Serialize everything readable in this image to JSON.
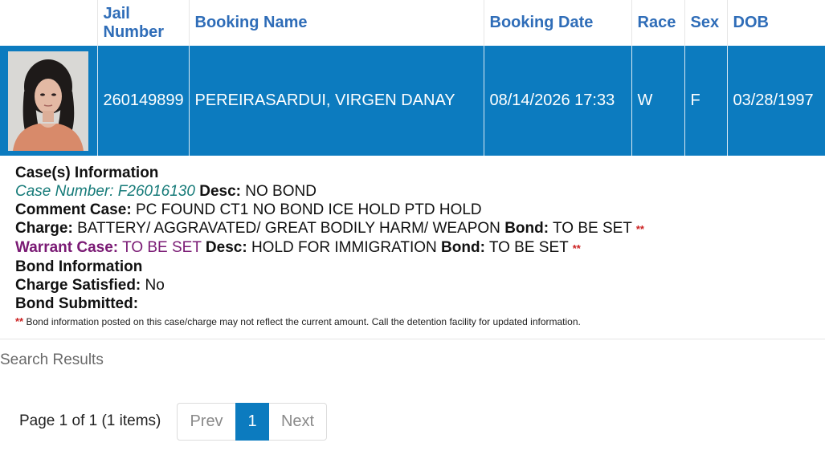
{
  "table": {
    "headers": {
      "photo": "",
      "jail_number": "Jail Number",
      "booking_name": "Booking Name",
      "booking_date": "Booking Date",
      "race": "Race",
      "sex": "Sex",
      "dob": "DOB"
    },
    "row": {
      "jail_number": "260149899",
      "booking_name": "PEREIRASARDUI, VIRGEN DANAY",
      "booking_date": "08/14/2026 17:33",
      "race": "W",
      "sex": "F",
      "dob": "03/28/1997"
    }
  },
  "case_info": {
    "title": "Case(s) Information",
    "case_number_label": "Case Number:",
    "case_number": "F26016130",
    "desc_label": "Desc:",
    "case_desc": "NO BOND",
    "comment_label": "Comment Case:",
    "comment": "PC FOUND CT1 NO BOND ICE HOLD PTD HOLD",
    "charge_label": "Charge:",
    "charge": "BATTERY/ AGGRAVATED/ GREAT BODILY HARM/ WEAPON",
    "bond_label": "Bond:",
    "charge_bond": "TO BE SET",
    "warrant_label": "Warrant Case:",
    "warrant_case": "TO BE SET",
    "warrant_desc_label": "Desc:",
    "warrant_desc": "HOLD FOR IMMIGRATION",
    "warrant_bond_label": "Bond:",
    "warrant_bond": "TO BE SET",
    "stars": "**",
    "bond_info_title": "Bond Information",
    "charge_satisfied_label": "Charge Satisfied:",
    "charge_satisfied": "No",
    "bond_submitted_label": "Bond Submitted:",
    "note": "Bond information posted on this case/charge may not reflect the current amount. Call the detention facility for updated information."
  },
  "search_results_label": "Search Results",
  "pagination": {
    "summary": "Page 1 of 1 (1 items)",
    "prev": "Prev",
    "current": "1",
    "next": "Next"
  },
  "colors": {
    "header_text": "#2f6db8",
    "selected_row": "#0c7bbf",
    "case_number": "#157a78",
    "warrant": "#7a1a74",
    "stars": "#cc2222"
  }
}
